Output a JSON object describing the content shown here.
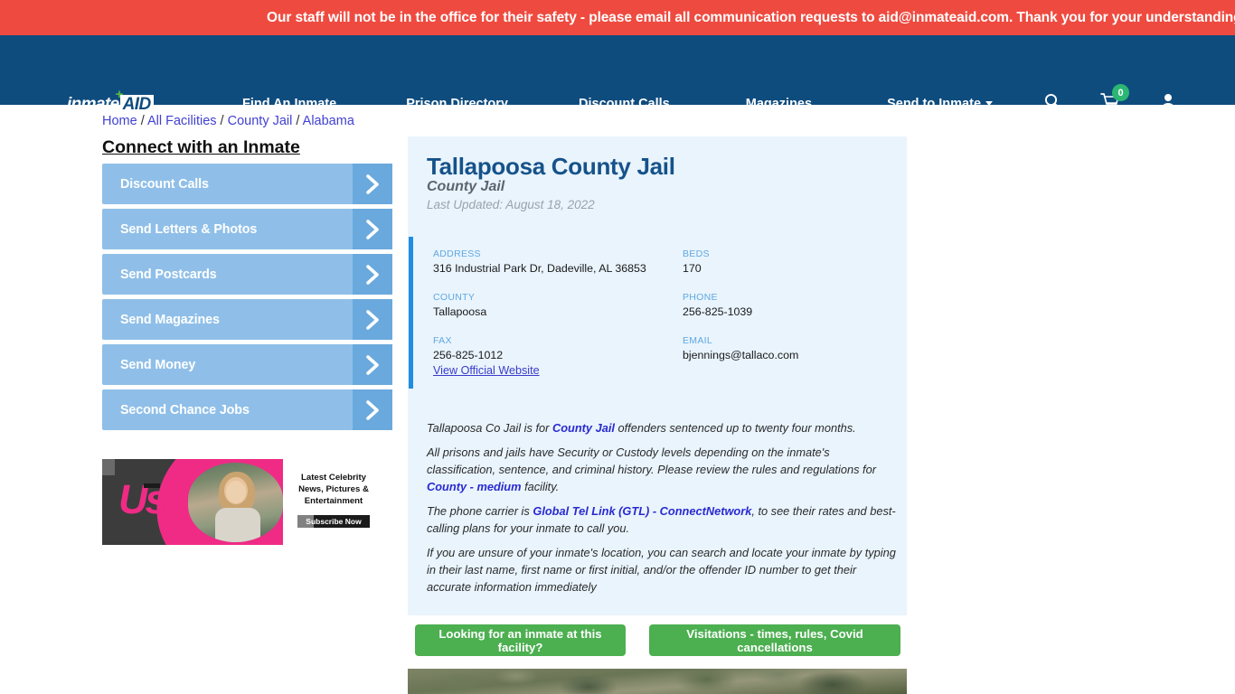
{
  "alert": {
    "message": "Our staff will not be in the office for their safety - please email all communication requests to aid@inmateaid.com. Thank you for your understanding."
  },
  "header": {
    "logo_word": "inmate",
    "logo_badge": "AID",
    "logo_plus": "+",
    "nav_items": [
      {
        "label": "Find An Inmate"
      },
      {
        "label": "Prison Directory"
      },
      {
        "label": "Discount Calls"
      },
      {
        "label": "Magazines"
      },
      {
        "label": "Send to Inmate"
      }
    ],
    "icons": {
      "search": "search-icon",
      "cart": "cart-icon",
      "cart_count": "0",
      "account": "user-icon"
    },
    "colors": {
      "navbar_bg": "#0f4c7e",
      "alert_bg": "#ef4a3f",
      "cart_badge": "#2bb673"
    }
  },
  "breadcrumb": {
    "items": [
      "Home",
      "All Facilities",
      "County Jail",
      "Alabama"
    ],
    "separator": "/"
  },
  "sidebar": {
    "title": "Connect with an Inmate",
    "items": [
      {
        "label": "Discount Calls"
      },
      {
        "label": "Send Letters & Photos"
      },
      {
        "label": "Send Postcards"
      },
      {
        "label": "Send Magazines"
      },
      {
        "label": "Send Money"
      },
      {
        "label": "Second Chance Jobs"
      }
    ]
  },
  "ad": {
    "brand": "Us",
    "headline": "Latest Celebrity News, Pictures & Entertainment",
    "cta": "Subscribe Now"
  },
  "facility": {
    "name": "Tallapoosa County Jail",
    "type": "County Jail",
    "last_updated": "Last Updated: August 18, 2022",
    "fields": [
      {
        "label": "ADDRESS",
        "value": "316 Industrial Park Dr, Dadeville, AL 36853"
      },
      {
        "label": "BEDS",
        "value": "170"
      },
      {
        "label": "COUNTY",
        "value": "Tallapoosa"
      },
      {
        "label": "PHONE",
        "value": "256-825-1039"
      },
      {
        "label": "FAX",
        "value": "256-825-1012"
      },
      {
        "label": "EMAIL",
        "value": "bjennings@tallaco.com"
      }
    ],
    "official_website_link": "View Official Website",
    "description": {
      "p1_a": "Tallapoosa Co Jail is for ",
      "p1_link": "County Jail",
      "p1_b": " offenders sentenced up to twenty four months.",
      "p2_a": "All prisons and jails have Security or Custody levels depending on the inmate's classification, sentence, and criminal history. Please review the rules and regulations for ",
      "p2_link": "County - medium",
      "p2_b": " facility.",
      "p3_a": "The phone carrier is ",
      "p3_link": "Global Tel Link (GTL) - ConnectNetwork",
      "p3_b": ", to see their rates and best-calling plans for your inmate to call you.",
      "p4": "If you are unsure of your inmate's location, you can search and locate your inmate by typing in their last name, first name or first initial, and/or the offender ID number to get their accurate information immediately"
    }
  },
  "actions": {
    "find_inmate": "Looking for an inmate at this facility?",
    "visitations": "Visitations - times, rules, Covid cancellations",
    "button_color": "#4caf50"
  }
}
